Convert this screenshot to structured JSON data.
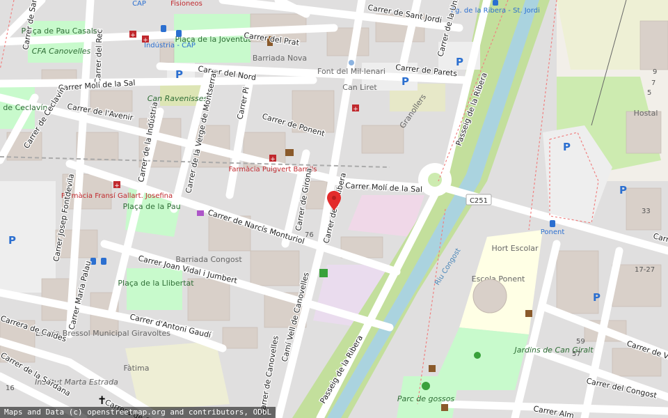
{
  "colors": {
    "road": "#ffffff",
    "building": "#d9d0c9",
    "park": "#c8facc",
    "water": "#aad3df",
    "railway": "#bbbbbb",
    "marker": "#e32b2b"
  },
  "streets": {
    "sant_eduard": "Carrer de Sant Eduard",
    "rec": "Carrer del Rec",
    "prat": "Carrer del Prat",
    "sant_jordi": "Carrer de Sant Jordi",
    "unio": "Carrer de la Unió",
    "parets": "Carrer de Parets",
    "nord": "Carrer del Nord",
    "moli_sal_w": "Carrer Molí de la Sal",
    "avenir": "Carrer de l'Avenir",
    "ceclavin": "Carrer de Ceclavín",
    "industria": "Carrer de la Indústria",
    "verge_montserrat": "Carrer de la Verge de Montserrat",
    "pi": "Carrer Pi",
    "ponent": "Carrer de Ponent",
    "ribera_n": "Passeig de la Ribera",
    "moli_sal_e": "Carrer Molí de la Sal",
    "girona": "Carrer de Girona",
    "ribera_street": "Carrer de la Ribera",
    "narcis": "Carrer de Narcís Monturiol",
    "josep_fontdevila": "Carrer Josep Fontdevila",
    "joan_vidal": "Carrer Joan Vidal i Jumbert",
    "maria_palau": "Carrer Maria Palau",
    "antoni_gaudi": "Carrer d'Antoni Gaudí",
    "cami_vell": "Camí Vell de Canovelles",
    "ribera_s": "Passeig de la Ribera",
    "caldes": "Carrera de Caldes",
    "sardana": "Carrer de la Sardana",
    "canovelles": "Carrer de Canovelles",
    "congost": "Carrer del Congost",
    "vall": "Carrer de Vall",
    "c251": "C251",
    "carrer_cut": "Carr",
    "alma": "Carrer Alm"
  },
  "places": {
    "placa_pau_casals": "Plaça de Pau Casals",
    "cfa": "CFA Canovelles",
    "placa_joventut": "Plaça de la Joventut",
    "barriada_nova": "Barriada Nova",
    "font_milenari": "Font del Mil·lenari",
    "can_liret": "Can Liret",
    "can_ravenisses": "Can Ravenisses",
    "placa_ceclavin": "Plaça de Ceclavín",
    "granollers": "Granollers",
    "placa_pau": "Plaça de la Pau",
    "barriada_congost": "Barriada Congost",
    "placa_llibertat": "Plaça de la Llibertat",
    "escola_bressol": "Escola Bressol Municipal Giravoltes",
    "fatima": "Fàtima",
    "institut": "Institut Marta Estrada",
    "riu_congost": "Riu Congost",
    "hort_escolar": "Hort Escolar",
    "escola_ponent": "Escola Ponent",
    "jardins": "Jardins de Can Giralt",
    "parc_gossos": "Parc de gossos",
    "hostal": "Hostal",
    "pharm_ind": "Farmàcia Fransí Gallart. Josefina",
    "pharm_pv": "Farmàcia Puigvert Barnils",
    "fisioneos": "Fisioneos",
    "bus_industria": "Indústria - CAP",
    "bus_cap": "CAP",
    "bus_ribera": "Pg. de la Ribera - St. Jordi",
    "bus_ponent": "Ponent"
  },
  "numbers": {
    "n76": "76",
    "n33": "33",
    "n1727": "17-27",
    "n59": "59",
    "n57": "57",
    "n16": "16",
    "n9": "9",
    "n7": "7",
    "n5": "5"
  },
  "icons": {
    "parking": "P",
    "pharmacy": "pharmacy-icon",
    "bus": "bus-icon",
    "shop": "shop-icon",
    "library": "book-icon",
    "monument": "monument-icon",
    "church": "cross-icon",
    "picnic": "picnic-icon",
    "dog": "dog-park-icon"
  },
  "attribution": "Maps and Data (c) openstreetmap.org and contributors, ODbL"
}
